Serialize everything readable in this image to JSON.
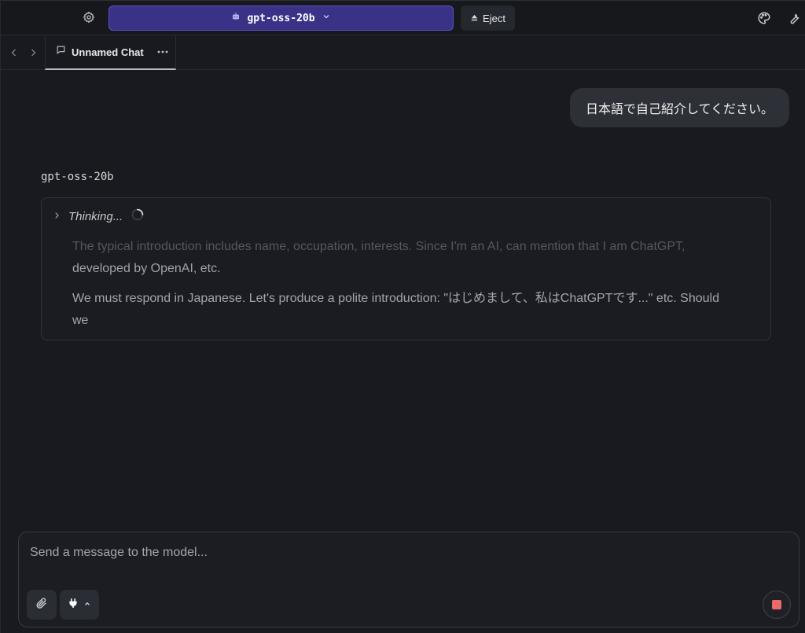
{
  "topbar": {
    "model_name": "gpt-oss-20b",
    "eject_label": "Eject"
  },
  "tabs": [
    {
      "label": "Unnamed Chat"
    }
  ],
  "chat": {
    "user_message": "日本語で自己紹介してください。",
    "assistant_name": "gpt-oss-20b",
    "thinking_label": "Thinking...",
    "thinking_paragraphs": [
      "The typical introduction includes name, occupation, interests. Since I'm an AI, can mention that I am ChatGPT, developed by OpenAI, etc.",
      "We must respond in Japanese. Let's produce a polite introduction: \"はじめまして、私はChatGPTです...\" etc. Should we"
    ]
  },
  "composer": {
    "placeholder": "Send a message to the model..."
  },
  "colors": {
    "accent": "#3a3287",
    "accent_border": "#5b52c9",
    "stop": "#ea6a6a",
    "background": "#181a1f"
  }
}
